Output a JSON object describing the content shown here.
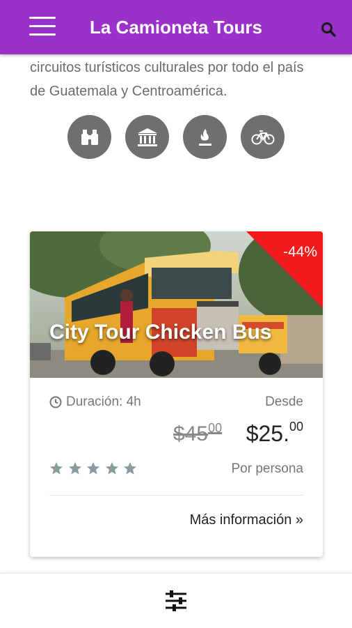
{
  "header": {
    "title": "La Camioneta Tours"
  },
  "intro": {
    "text": "circuitos turísticos culturales por todo el país de Guatemala y Centroamérica."
  },
  "categories": [
    {
      "icon": "binoculars-icon"
    },
    {
      "icon": "museum-icon"
    },
    {
      "icon": "volcano-icon"
    },
    {
      "icon": "bicycle-icon"
    }
  ],
  "tour_card": {
    "title": "City Tour Chicken Bus",
    "discount": "-44%",
    "duration": "Duración: 4h",
    "from_label": "Desde",
    "old_price_main": "$45",
    "old_price_cents": "00",
    "new_price_main": "$25.",
    "new_price_cents": "00",
    "rating_stars": 5,
    "per_person": "Por persona",
    "more_info": "Más información »"
  },
  "colors": {
    "header": "#9a32c9",
    "discount": "#f21a1a",
    "icon_circle": "#6f6f6f",
    "stars": "#8a9aa0"
  }
}
